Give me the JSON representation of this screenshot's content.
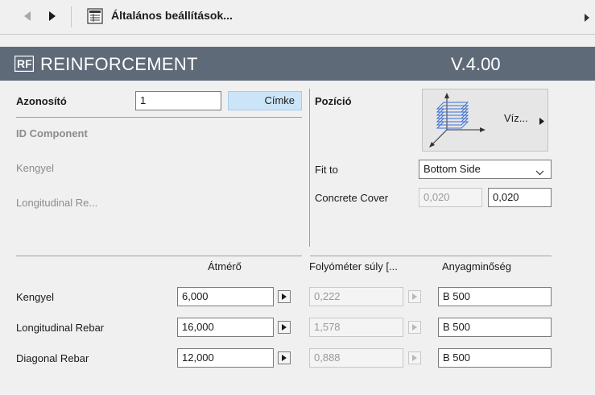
{
  "toolbar": {
    "title": "Általános beállítások..."
  },
  "header": {
    "title": "REINFORCEMENT",
    "version": "V.4.00"
  },
  "left_panel": {
    "id_label": "Azonosító",
    "id_value": "1",
    "label_button": "Címke",
    "id_component": "ID Component",
    "stirrup": "Kengyel",
    "longitudinal": "Longitudinal Re..."
  },
  "right_panel": {
    "position_label": "Pozíció",
    "position_button": "Víz...",
    "fit_to_label": "Fit to",
    "fit_to_value": "Bottom Side",
    "concrete_cover_label": "Concrete Cover",
    "concrete_cover_disabled": "0,020",
    "concrete_cover_value": "0,020"
  },
  "table": {
    "headers": [
      "Átmérő",
      "Folyóméter súly [...",
      "Anyagminőség"
    ],
    "rows": [
      {
        "label": "Kengyel",
        "diameter": "6,000",
        "weight": "0,222",
        "material": "B 500"
      },
      {
        "label": "Longitudinal Rebar",
        "diameter": "16,000",
        "weight": "1,578",
        "material": "B 500"
      },
      {
        "label": "Diagonal Rebar",
        "diameter": "12,000",
        "weight": "0,888",
        "material": "B 500"
      }
    ]
  }
}
